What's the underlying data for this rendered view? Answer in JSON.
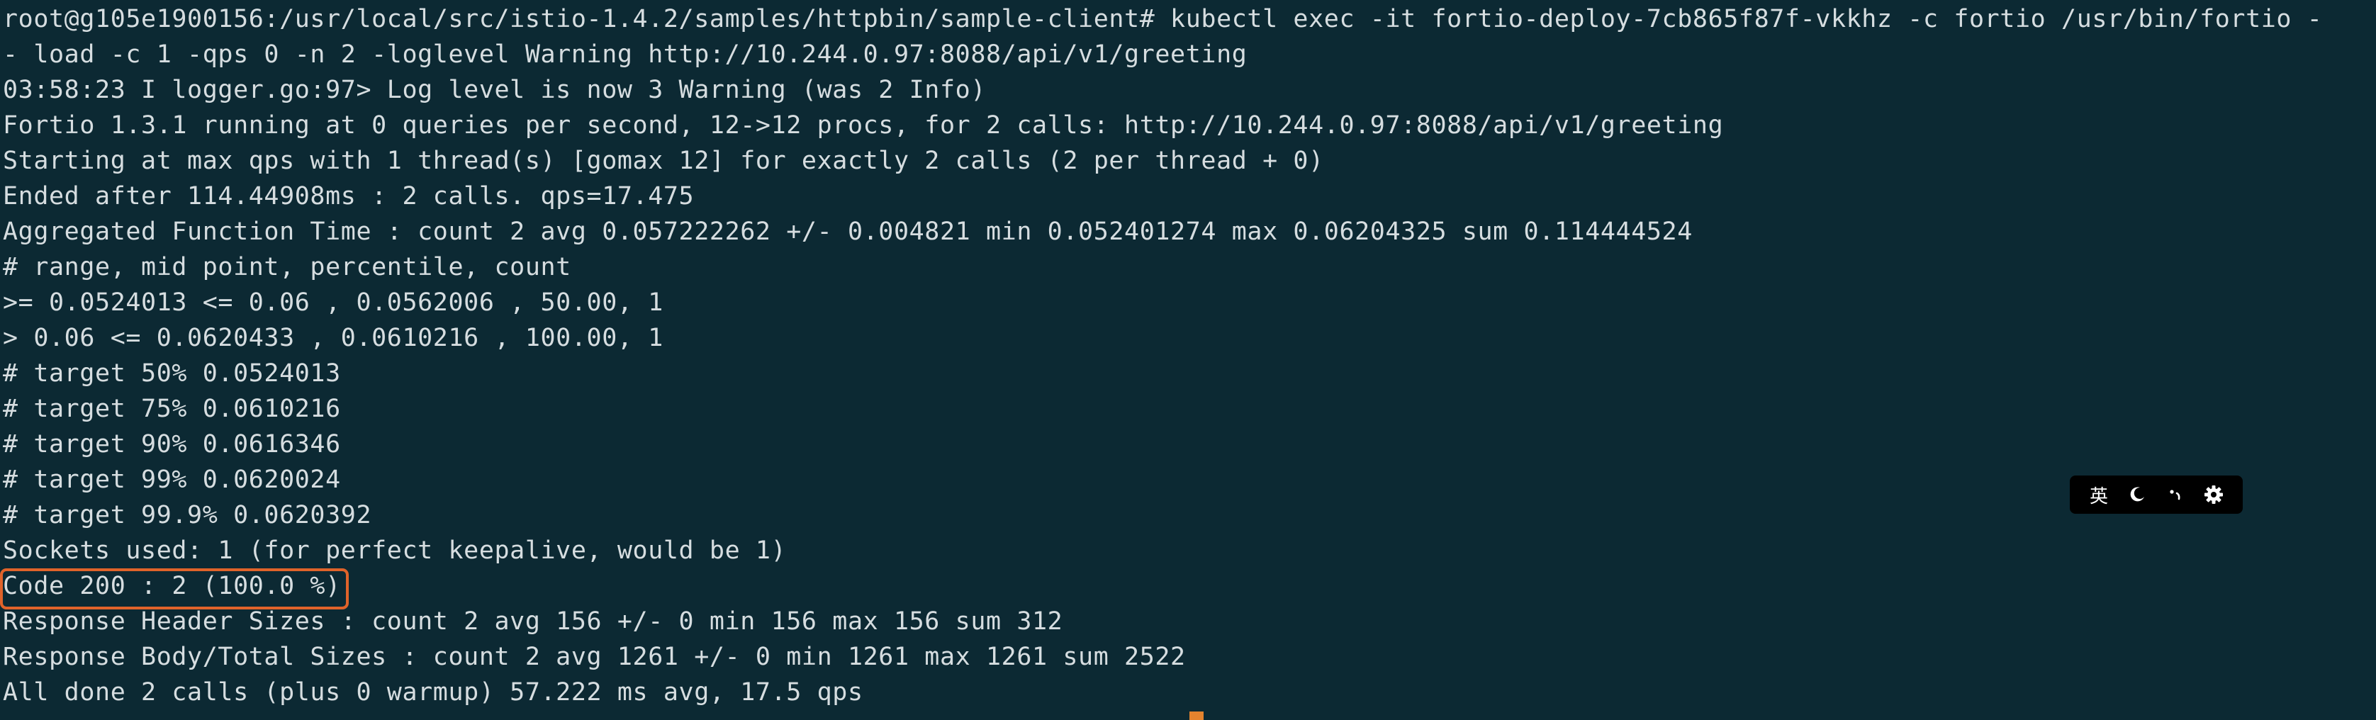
{
  "terminal": {
    "lines": [
      "root@g105e1900156:/usr/local/src/istio-1.4.2/samples/httpbin/sample-client# kubectl exec -it fortio-deploy-7cb865f87f-vkkhz -c fortio /usr/bin/fortio -",
      "- load -c 1 -qps 0 -n 2 -loglevel Warning http://10.244.0.97:8088/api/v1/greeting",
      "03:58:23 I logger.go:97> Log level is now 3 Warning (was 2 Info)",
      "Fortio 1.3.1 running at 0 queries per second, 12->12 procs, for 2 calls: http://10.244.0.97:8088/api/v1/greeting",
      "Starting at max qps with 1 thread(s) [gomax 12] for exactly 2 calls (2 per thread + 0)",
      "Ended after 114.44908ms : 2 calls. qps=17.475",
      "Aggregated Function Time : count 2 avg 0.057222262 +/- 0.004821 min 0.052401274 max 0.06204325 sum 0.114444524",
      "# range, mid point, percentile, count",
      ">= 0.0524013 <= 0.06 , 0.0562006 , 50.00, 1",
      "> 0.06 <= 0.0620433 , 0.0610216 , 100.00, 1",
      "# target 50% 0.0524013",
      "# target 75% 0.0610216",
      "# target 90% 0.0616346",
      "# target 99% 0.0620024",
      "# target 99.9% 0.0620392",
      "Sockets used: 1 (for perfect keepalive, would be 1)",
      "Code 200 : 2 (100.0 %)",
      "Response Header Sizes : count 2 avg 156 +/- 0 min 156 max 156 sum 312",
      "Response Body/Total Sizes : count 2 avg 1261 +/- 0 min 1261 max 1261 sum 2522",
      "All done 2 calls (plus 0 warmup) 57.222 ms avg, 17.5 qps"
    ]
  },
  "ime_toolbar": {
    "language_label": "英",
    "items": [
      "language-toggle",
      "moon-icon",
      "punctuation-icon",
      "gear-icon"
    ]
  },
  "colors": {
    "background": "#0c2933",
    "text": "#d6dde0",
    "highlight": "#e0632a",
    "cursor": "#e4832e",
    "toolbar_bg": "#000000"
  }
}
